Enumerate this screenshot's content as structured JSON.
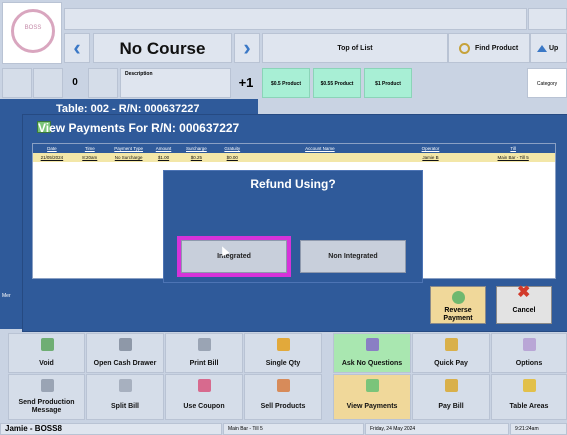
{
  "header": {
    "logo_text": "BOSS",
    "course": "No Course",
    "top_of_list": "Top of List",
    "find_product": "Find Product",
    "up": "Up",
    "count": "0",
    "description_label": "Description",
    "plus_one": "+1",
    "products": [
      "$0.5 Product",
      "$0.55 Product",
      "$1 Product"
    ],
    "category": "Category"
  },
  "table_bar": "Table: 002 - R/N: 000637227",
  "left_label": "Mer",
  "dialog": {
    "title": "View Payments For R/N: 000637227",
    "columns": [
      "Date",
      "Time",
      "Payment Type",
      "Amount",
      "Surcharge",
      "Gratuity",
      "Account Name",
      "Operator",
      "Till"
    ],
    "rows": [
      [
        "21/05/2024",
        "8:20am",
        "No Surcharge",
        "$1.00",
        "$0.25",
        "$0.00",
        "",
        "Jamie B",
        "Main Bar - Till 5"
      ]
    ],
    "reverse_label": "Reverse Payment",
    "cancel_label": "Cancel"
  },
  "refund": {
    "title": "Refund Using?",
    "integrated": "Integrated",
    "non_integrated": "Non Integrated"
  },
  "actions_row1": [
    "Void",
    "Open Cash Drawer",
    "Print Bill",
    "Single Qty",
    "Ask No Questions",
    "Quick Pay",
    "Options"
  ],
  "actions_row2": [
    "Send Production Message",
    "Split Bill",
    "Use Coupon",
    "Sell Products",
    "View Payments",
    "Pay Bill",
    "Table Areas"
  ],
  "status": {
    "user": "Jamie - BOSS8",
    "till": "Main Bar - Till 5",
    "date": "Friday, 24 May 2024",
    "time": "9:21:24am"
  },
  "colors": {
    "accent_blue": "#2f5a9a",
    "highlight": "#d633d9",
    "green_button": "#a9e7b0",
    "tan_button": "#f0d89a"
  }
}
